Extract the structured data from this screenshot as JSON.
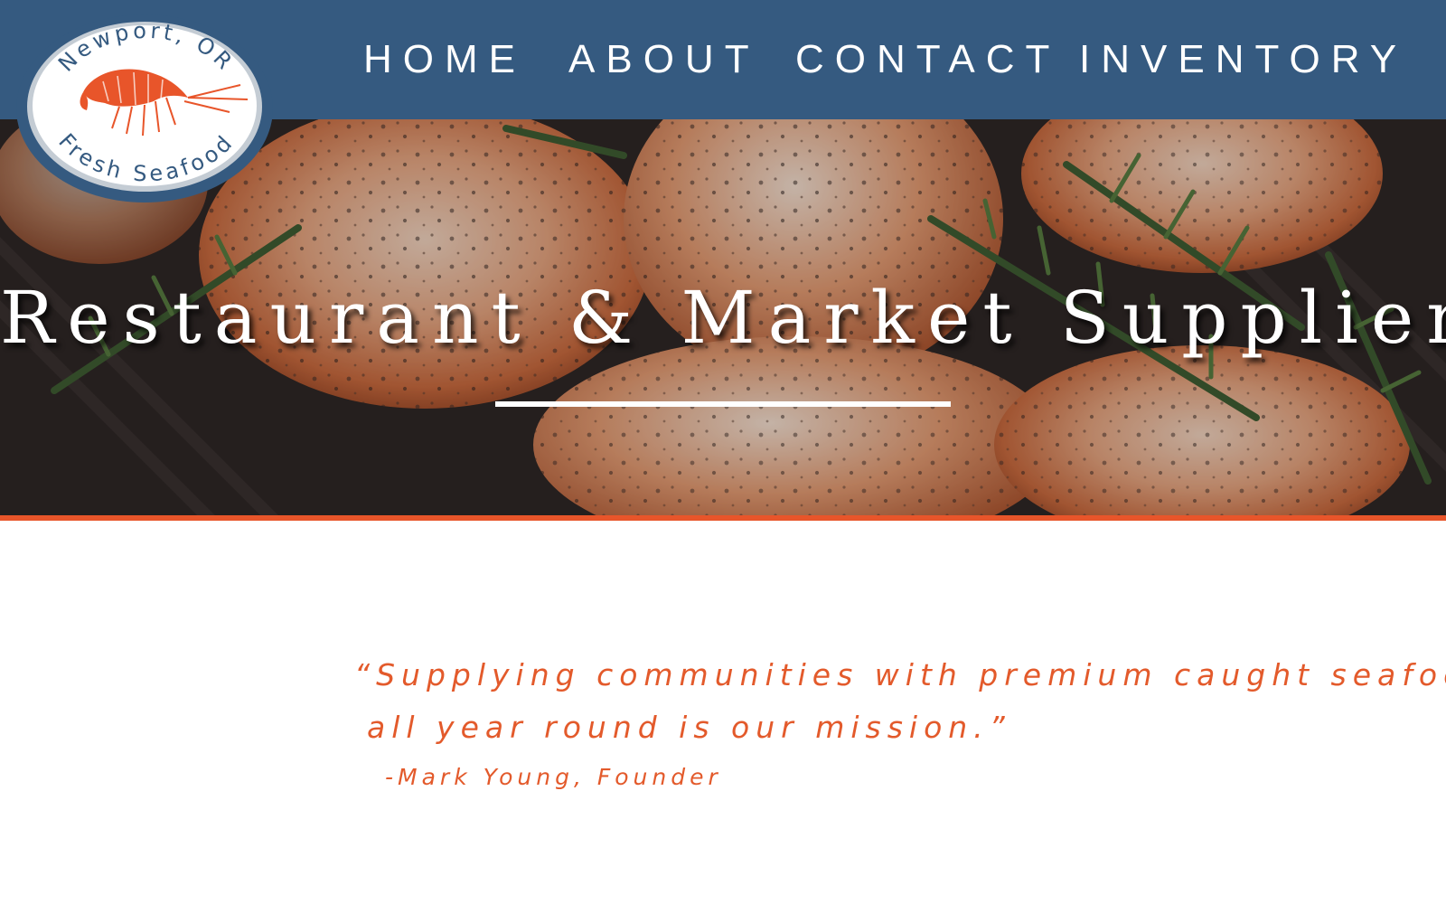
{
  "logo": {
    "top_text": "Newport, OR",
    "bottom_text": "Fresh Seafood",
    "icon": "shrimp-icon"
  },
  "nav": {
    "items": [
      {
        "label": "HOME"
      },
      {
        "label": "ABOUT"
      },
      {
        "label": "CONTACT"
      },
      {
        "label": "INVENTORY"
      }
    ]
  },
  "hero": {
    "title": "Restaurant & Market Supplier"
  },
  "quote": {
    "line1": "“Supplying communities with premium caught seafood",
    "line2": "all year round is our mission.”",
    "author": "-Mark Young, Founder"
  },
  "colors": {
    "header_bg": "#355a80",
    "accent": "#e8552a",
    "quote_text": "#e35a2b"
  }
}
